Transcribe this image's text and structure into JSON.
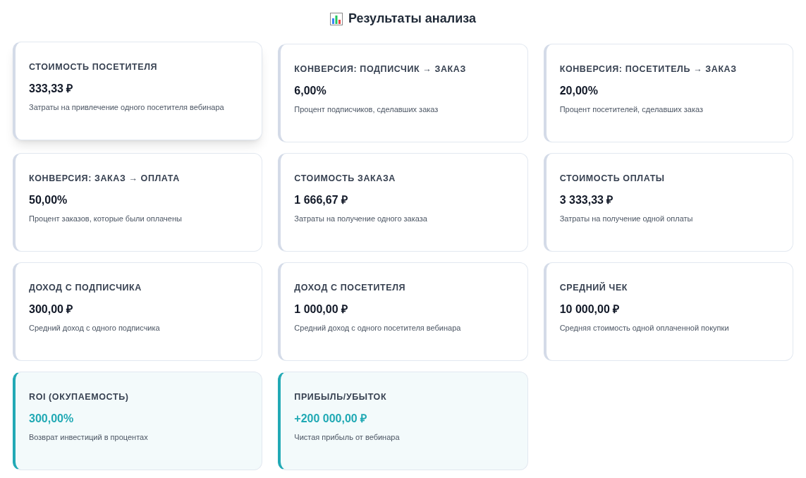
{
  "title": "Результаты анализа",
  "cards": [
    {
      "label": "СТОИМОСТЬ ПОСЕТИТЕЛЯ",
      "value": "333,33 ₽",
      "description": "Затраты на привлечение одного посетителя вебинара",
      "kind": "regular",
      "hovered": true
    },
    {
      "label": "КОНВЕРСИЯ: ПОДПИСЧИК → ЗАКАЗ",
      "value": "6,00%",
      "description": "Процент подписчиков, сделавших заказ",
      "kind": "regular",
      "hovered": false
    },
    {
      "label": "КОНВЕРСИЯ: ПОСЕТИТЕЛЬ → ЗАКАЗ",
      "value": "20,00%",
      "description": "Процент посетителей, сделавших заказ",
      "kind": "regular",
      "hovered": false
    },
    {
      "label": "КОНВЕРСИЯ: ЗАКАЗ → ОПЛАТА",
      "value": "50,00%",
      "description": "Процент заказов, которые были оплачены",
      "kind": "regular",
      "hovered": false
    },
    {
      "label": "СТОИМОСТЬ ЗАКАЗА",
      "value": "1 666,67 ₽",
      "description": "Затраты на получение одного заказа",
      "kind": "regular",
      "hovered": false
    },
    {
      "label": "СТОИМОСТЬ ОПЛАТЫ",
      "value": "3 333,33 ₽",
      "description": "Затраты на получение одной оплаты",
      "kind": "regular",
      "hovered": false
    },
    {
      "label": "ДОХОД С ПОДПИСЧИКА",
      "value": "300,00 ₽",
      "description": "Средний доход с одного подписчика",
      "kind": "regular",
      "hovered": false
    },
    {
      "label": "ДОХОД С ПОСЕТИТЕЛЯ",
      "value": "1 000,00 ₽",
      "description": "Средний доход с одного посетителя вебинара",
      "kind": "regular",
      "hovered": false
    },
    {
      "label": "СРЕДНИЙ ЧЕК",
      "value": "10 000,00 ₽",
      "description": "Средняя стоимость одной оплаченной покупки",
      "kind": "regular",
      "hovered": false
    },
    {
      "label": "ROI (ОКУПАЕМОСТЬ)",
      "value": "300,00%",
      "description": "Возврат инвестиций в процентах",
      "kind": "highlight",
      "hovered": false
    },
    {
      "label": "ПРИБЫЛЬ/УБЫТОК",
      "value": "+200 000,00 ₽",
      "description": "Чистая прибыль от вебинара",
      "kind": "highlight",
      "hovered": false
    }
  ]
}
